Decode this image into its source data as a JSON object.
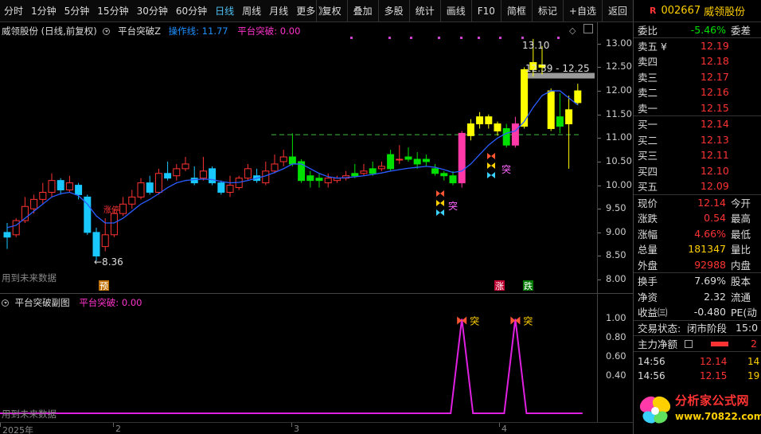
{
  "toolbar": {
    "periods": [
      "分时",
      "1分钟",
      "5分钟",
      "15分钟",
      "30分钟",
      "60分钟",
      "日线",
      "周线",
      "月线",
      "更多 》"
    ],
    "active_period": "日线",
    "tools": [
      "复权",
      "叠加",
      "多股",
      "统计",
      "画线",
      "F10",
      "简框",
      "标记",
      "+自选",
      "返回"
    ]
  },
  "main_chart": {
    "stock_label": "威领股份 (日线,前复权)",
    "indicator_name": "平台突破Z",
    "line_label": "操作线: 11.77",
    "breakout_label": "平台突破: 0.00",
    "future_data_note": "用到未来数据",
    "high_annotation": "13.10",
    "low_annotation": "←8.36",
    "range_annotation": "12.39 - 12.25",
    "marker_tu": "突",
    "marker_zhangting": "涨停",
    "marker_yu": "预",
    "marker_zhang": "涨",
    "marker_die": "跌"
  },
  "sub_chart": {
    "title": "平台突破副图",
    "value_label": "平台突破: 0.00",
    "future_data_note": "用到未来数据",
    "marker_tu": "突",
    "axis_ticks": [
      "1.00",
      "0.80",
      "0.60",
      "0.40"
    ]
  },
  "date_axis": {
    "labels": [
      "2025年",
      "2",
      "3",
      "4"
    ]
  },
  "chart_data": {
    "type": "candlestick",
    "price_axis": {
      "ticks": [
        13.0,
        12.5,
        12.0,
        11.5,
        11.0,
        10.5,
        10.0,
        9.5,
        9.0,
        8.5,
        8.0
      ],
      "ylim": [
        7.85,
        13.25
      ]
    },
    "platform_level": 11.07,
    "candles": [
      {
        "o": 9.0,
        "c": 8.9,
        "h": 9.2,
        "l": 8.65
      },
      {
        "o": 8.95,
        "c": 9.25,
        "h": 9.3,
        "l": 8.9
      },
      {
        "o": 9.25,
        "c": 9.55,
        "h": 9.75,
        "l": 9.2
      },
      {
        "o": 9.5,
        "c": 9.7,
        "h": 9.8,
        "l": 9.4
      },
      {
        "o": 9.7,
        "c": 9.85,
        "h": 10.05,
        "l": 9.6
      },
      {
        "o": 9.85,
        "c": 10.1,
        "h": 10.25,
        "l": 9.75
      },
      {
        "o": 10.1,
        "c": 9.9,
        "h": 10.15,
        "l": 9.8
      },
      {
        "o": 9.9,
        "c": 10.05,
        "h": 10.2,
        "l": 9.85
      },
      {
        "o": 10.0,
        "c": 9.8,
        "h": 10.05,
        "l": 9.7
      },
      {
        "o": 9.75,
        "c": 9.0,
        "h": 9.8,
        "l": 8.95
      },
      {
        "o": 9.0,
        "c": 8.5,
        "h": 9.1,
        "l": 8.4
      },
      {
        "o": 8.7,
        "c": 8.95,
        "h": 9.3,
        "l": 8.6
      },
      {
        "o": 8.95,
        "c": 9.4,
        "h": 9.5,
        "l": 8.9
      },
      {
        "o": 9.4,
        "c": 9.6,
        "h": 9.75,
        "l": 9.35
      },
      {
        "o": 9.6,
        "c": 9.75,
        "h": 9.9,
        "l": 9.5
      },
      {
        "o": 9.75,
        "c": 10.05,
        "h": 10.15,
        "l": 9.7
      },
      {
        "o": 10.05,
        "c": 9.85,
        "h": 10.2,
        "l": 9.8
      },
      {
        "o": 9.85,
        "c": 10.25,
        "h": 10.35,
        "l": 9.8
      },
      {
        "o": 10.25,
        "c": 10.15,
        "h": 10.5,
        "l": 10.1
      },
      {
        "o": 10.2,
        "c": 10.35,
        "h": 10.45,
        "l": 10.1
      },
      {
        "o": 10.35,
        "c": 10.45,
        "h": 10.6,
        "l": 10.3
      },
      {
        "o": 10.15,
        "c": 10.05,
        "h": 10.4,
        "l": 10.0
      },
      {
        "o": 10.15,
        "c": 10.3,
        "h": 10.6,
        "l": 10.1
      },
      {
        "o": 10.35,
        "c": 10.05,
        "h": 10.4,
        "l": 10.0
      },
      {
        "o": 10.05,
        "c": 9.85,
        "h": 10.1,
        "l": 9.8
      },
      {
        "o": 9.85,
        "c": 10.0,
        "h": 10.2,
        "l": 9.75
      },
      {
        "o": 9.95,
        "c": 10.15,
        "h": 10.2,
        "l": 9.9
      },
      {
        "o": 10.15,
        "c": 10.35,
        "h": 10.45,
        "l": 10.1
      },
      {
        "o": 10.2,
        "c": 10.1,
        "h": 10.35,
        "l": 10.05
      },
      {
        "o": 10.05,
        "c": 10.3,
        "h": 10.5,
        "l": 10.0
      },
      {
        "o": 10.3,
        "c": 10.45,
        "h": 10.65,
        "l": 10.25
      },
      {
        "o": 10.5,
        "c": 10.6,
        "h": 10.75,
        "l": 10.4
      },
      {
        "o": 10.6,
        "c": 10.45,
        "h": 11.1,
        "l": 10.4
      },
      {
        "o": 10.5,
        "c": 10.1,
        "h": 10.55,
        "l": 10.05
      },
      {
        "o": 10.2,
        "c": 10.1,
        "h": 10.3,
        "l": 9.95
      },
      {
        "o": 10.15,
        "c": 10.1,
        "h": 10.25,
        "l": 9.95
      },
      {
        "o": 10.05,
        "c": 10.15,
        "h": 10.25,
        "l": 9.95
      },
      {
        "o": 10.1,
        "c": 10.15,
        "h": 10.2,
        "l": 10.05
      },
      {
        "o": 10.15,
        "c": 10.2,
        "h": 10.3,
        "l": 10.1
      },
      {
        "o": 10.25,
        "c": 10.2,
        "h": 10.45,
        "l": 10.15
      },
      {
        "o": 10.25,
        "c": 10.3,
        "h": 10.45,
        "l": 10.2
      },
      {
        "o": 10.35,
        "c": 10.25,
        "h": 10.5,
        "l": 10.2
      },
      {
        "o": 10.35,
        "c": 10.4,
        "h": 10.5,
        "l": 10.3
      },
      {
        "o": 10.65,
        "c": 10.35,
        "h": 10.75,
        "l": 10.3
      },
      {
        "o": 10.55,
        "c": 10.55,
        "h": 10.85,
        "l": 10.45
      },
      {
        "o": 10.6,
        "c": 10.55,
        "h": 10.8,
        "l": 10.5
      },
      {
        "o": 10.55,
        "c": 10.45,
        "h": 10.7,
        "l": 10.35
      },
      {
        "o": 10.55,
        "c": 10.5,
        "h": 10.65,
        "l": 10.4
      },
      {
        "o": 10.35,
        "c": 10.25,
        "h": 10.45,
        "l": 10.2
      },
      {
        "o": 10.25,
        "c": 10.2,
        "h": 10.3,
        "l": 10.1
      },
      {
        "o": 10.2,
        "c": 10.05,
        "h": 10.3,
        "l": 10.0
      },
      {
        "o": 10.05,
        "c": 11.1,
        "h": 11.15,
        "l": 9.95
      },
      {
        "o": 11.05,
        "c": 11.3,
        "h": 11.4,
        "l": 10.95
      },
      {
        "o": 11.3,
        "c": 11.45,
        "h": 11.55,
        "l": 11.2
      },
      {
        "o": 11.45,
        "c": 11.3,
        "h": 11.5,
        "l": 11.2
      },
      {
        "o": 11.3,
        "c": 11.15,
        "h": 11.35,
        "l": 11.05
      },
      {
        "o": 11.2,
        "c": 10.85,
        "h": 11.3,
        "l": 10.8
      },
      {
        "o": 10.85,
        "c": 11.3,
        "h": 11.45,
        "l": 10.8
      },
      {
        "o": 11.25,
        "c": 12.45,
        "h": 12.5,
        "l": 11.2
      },
      {
        "o": 12.45,
        "c": 12.6,
        "h": 13.1,
        "l": 12.3
      },
      {
        "o": 12.55,
        "c": 12.5,
        "h": 12.95,
        "l": 12.35
      },
      {
        "o": 12.0,
        "c": 11.2,
        "h": 12.05,
        "l": 11.15
      },
      {
        "o": 11.25,
        "c": 11.45,
        "h": 11.95,
        "l": 11.1
      },
      {
        "o": 11.3,
        "c": 11.6,
        "h": 11.9,
        "l": 10.35
      },
      {
        "o": 11.75,
        "c": 12.0,
        "h": 12.15,
        "l": 11.7
      }
    ],
    "ma_line": [
      9.1,
      9.15,
      9.3,
      9.45,
      9.6,
      9.75,
      9.82,
      9.85,
      9.78,
      9.6,
      9.35,
      9.2,
      9.2,
      9.3,
      9.45,
      9.6,
      9.7,
      9.82,
      9.95,
      10.05,
      10.1,
      10.12,
      10.13,
      10.12,
      10.08,
      10.05,
      10.06,
      10.1,
      10.15,
      10.2,
      10.27,
      10.35,
      10.45,
      10.45,
      10.35,
      10.25,
      10.18,
      10.15,
      10.16,
      10.18,
      10.2,
      10.23,
      10.26,
      10.3,
      10.33,
      10.36,
      10.38,
      10.4,
      10.38,
      10.33,
      10.27,
      10.3,
      10.45,
      10.65,
      10.85,
      11.0,
      11.1,
      11.15,
      11.35,
      11.65,
      11.9,
      12.0,
      12.0,
      11.85,
      11.7
    ],
    "sub_signal": {
      "ylim": [
        0,
        1.08
      ],
      "spikes": [
        51,
        57
      ]
    }
  },
  "panel": {
    "code": "002667",
    "name": "威领股份",
    "weibi_label": "委比",
    "weibi_value": "-5.46%",
    "weicha_label": "委差",
    "sells": [
      {
        "label": "卖五 ¥",
        "price": "12.19"
      },
      {
        "label": "卖四",
        "price": "12.18"
      },
      {
        "label": "卖三",
        "price": "12.17"
      },
      {
        "label": "卖二",
        "price": "12.16"
      },
      {
        "label": "卖一",
        "price": "12.15"
      }
    ],
    "buys": [
      {
        "label": "买一",
        "price": "12.14"
      },
      {
        "label": "买二",
        "price": "12.13"
      },
      {
        "label": "买三",
        "price": "12.11"
      },
      {
        "label": "买四",
        "price": "12.10"
      },
      {
        "label": "买五",
        "price": "12.09"
      }
    ],
    "stats": [
      {
        "label": "现价",
        "value": "12.14",
        "color": "red",
        "label2": "今开"
      },
      {
        "label": "涨跌",
        "value": "0.54",
        "color": "red",
        "label2": "最高"
      },
      {
        "label": "涨幅",
        "value": "4.66%",
        "color": "red",
        "label2": "最低"
      },
      {
        "label": "总量",
        "value": "181347",
        "color": "yellow",
        "label2": "量比"
      },
      {
        "label": "外盘",
        "value": "92988",
        "color": "red",
        "label2": "内盘"
      }
    ],
    "stats2": [
      {
        "label": "换手",
        "value": "7.69%",
        "color": "white",
        "label2": "股本"
      },
      {
        "label": "净资",
        "value": "2.32",
        "color": "white",
        "label2": "流通"
      },
      {
        "label": "收益㈢",
        "value": "-0.480",
        "color": "white",
        "label2": "PE(动"
      }
    ],
    "trade_status_label": "交易状态:",
    "trade_status_value": "闭市阶段",
    "trade_status_time": "15:0",
    "main_flow_label": "主力净额",
    "main_flow_digit": "2",
    "trades": [
      {
        "time": "14:56",
        "price": "12.14",
        "vol": "14"
      },
      {
        "time": "14:56",
        "price": "12.15",
        "vol": "19"
      }
    ],
    "logo_title": "分析家公式网",
    "logo_url": "www.70822.com"
  }
}
